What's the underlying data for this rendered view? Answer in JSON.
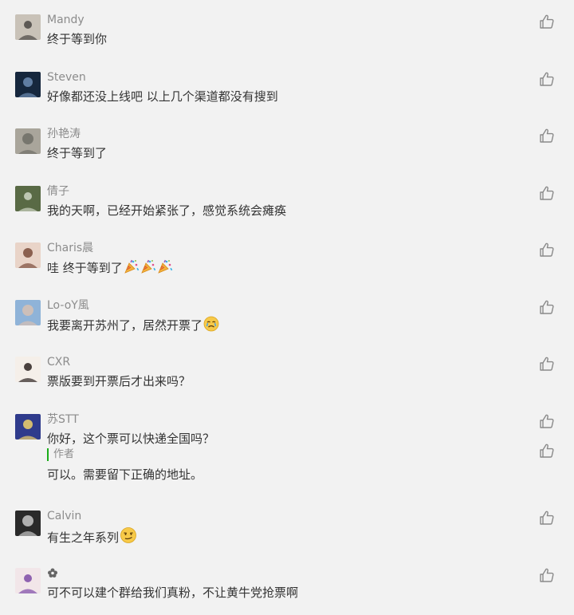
{
  "comments": [
    {
      "nickname": "Mandy",
      "content": "终于等到你",
      "avatar_colors": [
        "#c9c2b8",
        "#4a4643"
      ],
      "emojis": []
    },
    {
      "nickname": "Steven",
      "content": "好像都还没上线吧 以上几个渠道都没有搜到",
      "avatar_colors": [
        "#16273d",
        "#6d8db4"
      ],
      "emojis": []
    },
    {
      "nickname": "孙艳涛",
      "content": "终于等到了",
      "avatar_colors": [
        "#a9a59b",
        "#6f6d66"
      ],
      "emojis": []
    },
    {
      "nickname": "倩子",
      "content": "我的天啊，已经开始紧张了，感觉系统会瘫痪",
      "avatar_colors": [
        "#596a45",
        "#cfd6c5"
      ],
      "emojis": []
    },
    {
      "nickname": "Charis晨",
      "content": "哇 终于等到了",
      "avatar_colors": [
        "#e9d4c8",
        "#7a4b3a"
      ],
      "emojis": [
        "party-popper",
        "party-popper",
        "party-popper"
      ]
    },
    {
      "nickname": "Lo-oY風",
      "content": "我要离开苏州了，居然开票了",
      "avatar_colors": [
        "#8fb3d8",
        "#d7c1b4"
      ],
      "emojis": [
        "sob-face"
      ]
    },
    {
      "nickname": "CXR",
      "content": "票版要到开票后才出来吗？",
      "avatar_colors": [
        "#f5efe9",
        "#2b2220"
      ],
      "emojis": []
    },
    {
      "nickname": "苏STT",
      "content": "你好，这个票可以快递全国吗？",
      "avatar_colors": [
        "#2f3b8c",
        "#f0d26a"
      ],
      "emojis": [],
      "reply": {
        "tag": "作者",
        "text": "可以。需要留下正确的地址。"
      }
    },
    {
      "nickname": "Calvin",
      "content": "有生之年系列",
      "avatar_colors": [
        "#2a2a2a",
        "#c8c8c8"
      ],
      "emojis": [
        "smirk-face"
      ]
    },
    {
      "nickname": "",
      "content": "可不可以建个群给我们真粉，不让黄牛党抢票啊",
      "avatar_colors": [
        "#f2e6e9",
        "#7e4aa6"
      ],
      "emojis": [],
      "nickname_icon": "flower-icon"
    }
  ],
  "colors": {
    "background": "#f2f2f2",
    "nickname": "#8c8c8c",
    "content": "#333333",
    "like_icon": "#8a8a8a",
    "author_accent": "#1aad19"
  }
}
